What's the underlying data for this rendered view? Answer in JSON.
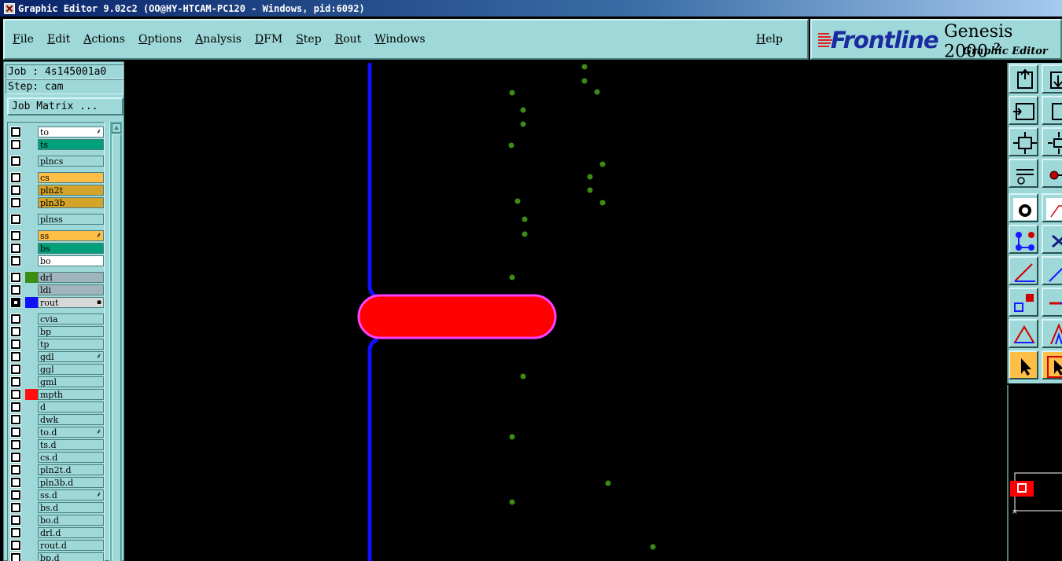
{
  "window": {
    "title": "Graphic Editor 9.02c2 (OO@HY-HTCAM-PC120 - Windows, pid:6092)"
  },
  "menu": {
    "items": [
      "File",
      "Edit",
      "Actions",
      "Options",
      "Analysis",
      "DFM",
      "Step",
      "Rout",
      "Windows"
    ],
    "help": "Help"
  },
  "logo": {
    "brand": "Frontline",
    "product": "Genesis 2000",
    "product_sup": "2",
    "subtitle": "Graphic Editor"
  },
  "job_info": {
    "job": "Job : 4s145001a0",
    "step": "Step: cam",
    "matrix_button": "Job Matrix ..."
  },
  "layers": [
    {
      "name": "to",
      "bg": "#ffffff",
      "mark": "⸙"
    },
    {
      "name": "ts",
      "bg": "#00a07a"
    },
    {
      "name": "plncs",
      "bg": "#9ed8d8"
    },
    {
      "name": "cs",
      "bg": "#ffbe45"
    },
    {
      "name": "pln2t",
      "bg": "#d4a32a"
    },
    {
      "name": "pln3b",
      "bg": "#d4a32a"
    },
    {
      "name": "plnss",
      "bg": "#9ed8d8"
    },
    {
      "name": "ss",
      "bg": "#ffbe45",
      "mark": "⸙"
    },
    {
      "name": "bs",
      "bg": "#00a07a"
    },
    {
      "name": "bo",
      "bg": "#ffffff"
    },
    {
      "name": "drl",
      "bg": "#a0b4bc",
      "swatch": "#3c8c14"
    },
    {
      "name": "ldi",
      "bg": "#a0b4bc"
    },
    {
      "name": "rout",
      "bg": "#d8d8d8",
      "swatch": "#1010ff",
      "checked": true,
      "mark": "▪"
    },
    {
      "name": "cvia",
      "bg": "#9ed8d8"
    },
    {
      "name": "bp",
      "bg": "#9ed8d8"
    },
    {
      "name": "tp",
      "bg": "#9ed8d8"
    },
    {
      "name": "gdl",
      "bg": "#9ed8d8",
      "mark": "⸙"
    },
    {
      "name": "ggl",
      "bg": "#9ed8d8"
    },
    {
      "name": "gml",
      "bg": "#9ed8d8"
    },
    {
      "name": "mpth",
      "bg": "#9ed8d8",
      "swatch": "#ff1010"
    },
    {
      "name": "d",
      "bg": "#9ed8d8"
    },
    {
      "name": "dwk",
      "bg": "#9ed8d8"
    },
    {
      "name": "to.d",
      "bg": "#9ed8d8",
      "mark": "⸙"
    },
    {
      "name": "ts.d",
      "bg": "#9ed8d8"
    },
    {
      "name": "cs.d",
      "bg": "#9ed8d8"
    },
    {
      "name": "pln2t.d",
      "bg": "#9ed8d8"
    },
    {
      "name": "pln3b.d",
      "bg": "#9ed8d8"
    },
    {
      "name": "ss.d",
      "bg": "#9ed8d8",
      "mark": "⸙"
    },
    {
      "name": "bs.d",
      "bg": "#9ed8d8"
    },
    {
      "name": "bo.d",
      "bg": "#9ed8d8"
    },
    {
      "name": "drl.d",
      "bg": "#9ed8d8"
    },
    {
      "name": "rout.d",
      "bg": "#9ed8d8"
    },
    {
      "name": "bp.d",
      "bg": "#9ed8d8"
    }
  ],
  "colors": {
    "rout_line": "#1010ff",
    "slot_fill": "#ff0000",
    "slot_outline": "#ff40ff",
    "drill_dot": "#3c8c14",
    "panel_bg": "#9ed8d8",
    "active_tool": "#ffbe45"
  },
  "tools": [
    {
      "icon": "zoom-home-icon"
    },
    {
      "icon": "zoom-home-alt-icon"
    },
    {
      "icon": "zoom-in-icon"
    },
    {
      "icon": "zoom-in-alt-icon"
    },
    {
      "icon": "fit-screen-icon"
    },
    {
      "icon": "fit-screen-alt-icon"
    },
    {
      "icon": "measure-icon"
    },
    {
      "icon": "snap-icon"
    },
    {
      "icon": "pad-select-icon"
    },
    {
      "icon": "polygon-icon"
    },
    {
      "icon": "net-icon"
    },
    {
      "icon": "cross-icon"
    },
    {
      "icon": "angle-icon"
    },
    {
      "icon": "angle-alt-icon"
    },
    {
      "icon": "pad-add-icon"
    },
    {
      "icon": "line-add-icon"
    },
    {
      "icon": "triangle-icon"
    },
    {
      "icon": "triangle-alt-icon"
    },
    {
      "icon": "pointer-icon",
      "active": true
    },
    {
      "icon": "pointer-alt-icon",
      "active": true
    }
  ]
}
